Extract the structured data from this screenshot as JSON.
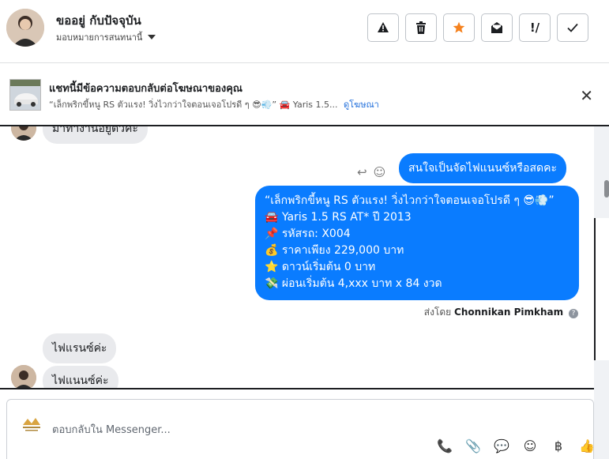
{
  "header": {
    "contact_name": "ขออยู่ กับปัจจุบัน",
    "assign_label": "มอบหมายการสนทนานี้",
    "actions": [
      {
        "name": "report-spam-button",
        "glyph": "⚠"
      },
      {
        "name": "delete-button",
        "glyph": "🗑"
      },
      {
        "name": "star-button",
        "glyph": "★"
      },
      {
        "name": "mark-unread-button",
        "glyph": "✉"
      },
      {
        "name": "follow-up-button",
        "glyph": "!!"
      },
      {
        "name": "mark-done-button",
        "glyph": "✓"
      }
    ]
  },
  "banner": {
    "title": "แชทนี้มีข้อความตอบกลับต่อโฆษณาของคุณ",
    "subtitle": "“เล็กพริกขี้หนู RS ตัวแรง! วิ่งไวกว่าใจตอนเจอโปรดี ๆ 😎💨” 🚘 Yaris 1.5...",
    "view_ad_link": "ดูโฆษณา",
    "close_glyph": "✕"
  },
  "conversation": {
    "partial_top_msg": "มาทำงานอยู่ตัวคะ",
    "out_short": "สนใจเป็นจัดไฟแนนซ์หรือสดคะ",
    "out_long_lines": [
      "“เล็กพริกขี้หนู RS ตัวแรง! วิ่งไวกว่าใจตอนเจอโปรดี ๆ 😎💨”",
      "🚘 Yaris 1.5 RS AT* ปี 2013",
      "📌 รหัสรถ: X004",
      "💰 ราคาเพียง 229,000 บาท",
      "⭐ ดาวน์เริ่มต้น 0 บาท",
      "💸 ผ่อนเริ่มต้น 4,xxx บาท x 84 งวด"
    ],
    "sent_by_prefix": "ส่งโดย",
    "sent_by_name": "Chonnikan Pimkham",
    "in_msg_1": "ไฟแรนซ์ค่ะ",
    "in_msg_2": "ไฟแนนซ์ค่ะ"
  },
  "composer": {
    "placeholder": "ตอบกลับใน Messenger...",
    "tools": [
      "📞",
      "📎",
      "💬",
      "☺",
      "฿",
      "👍"
    ]
  },
  "colors": {
    "outgoing_bubble": "#0a7cff",
    "incoming_bubble": "#e9eaed",
    "star_orange": "#f5821f",
    "link_blue": "#216fdb"
  }
}
